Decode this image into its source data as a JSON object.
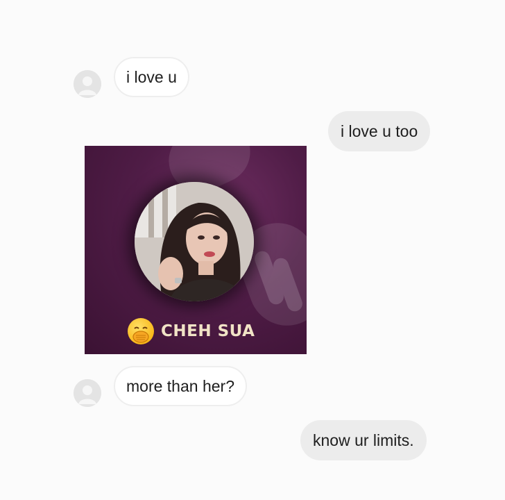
{
  "messages": [
    {
      "text": "i love u"
    },
    {
      "text": "i love u too"
    },
    {
      "text": "more than her?"
    },
    {
      "text": "know ur limits."
    }
  ],
  "shared_image": {
    "caption": "CHEH SUA",
    "emoji": "hand-over-mouth-emoji"
  },
  "colors": {
    "background": "#fbfbfb",
    "incoming_bubble": "#ffffff",
    "outgoing_bubble": "#ececec",
    "image_background": "#4f1c46",
    "caption_text": "#f1e3c6"
  }
}
